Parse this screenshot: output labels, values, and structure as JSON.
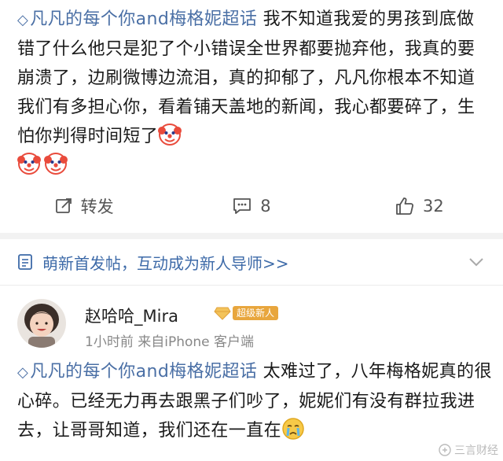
{
  "post": {
    "topic": "凡凡的每个你and梅格妮超话",
    "text": " 我不知道我爱的男孩到底做错了什么他只是犯了个小错误全世界都要抛弃他，我真的要崩溃了，边刷微博边流泪，真的抑郁了，凡凡你根本不知道我们有多担心你，看着铺天盖地的新闻，我心都要碎了，生怕你判得时间短了",
    "emojis": [
      "clown-face-emoji",
      "clown-face-emoji",
      "clown-face-emoji"
    ]
  },
  "actions": {
    "repost_label": "转发",
    "comment_count": "8",
    "like_count": "32"
  },
  "promo": {
    "label": "萌新首发帖，互动成为新人导师>>"
  },
  "comment": {
    "username": "赵哈哈_Mira",
    "badge": "超级新人",
    "meta": "1小时前  来自iPhone 客户端",
    "topic": "凡凡的每个你and梅格妮超话",
    "text": " 太难过了，八年梅格妮真的很心碎。已经无力再去跟黑子们吵了，妮妮们有没有群拉我进去，让哥哥知道，我们还在一直在",
    "emoji": "crying-face-emoji"
  },
  "watermark": {
    "text": "三言财经"
  },
  "colors": {
    "topic_blue": "#4a6fa5",
    "link_blue": "#3d6aa8",
    "badge_orange": "#e8a63d",
    "meta_gray": "#888888"
  }
}
